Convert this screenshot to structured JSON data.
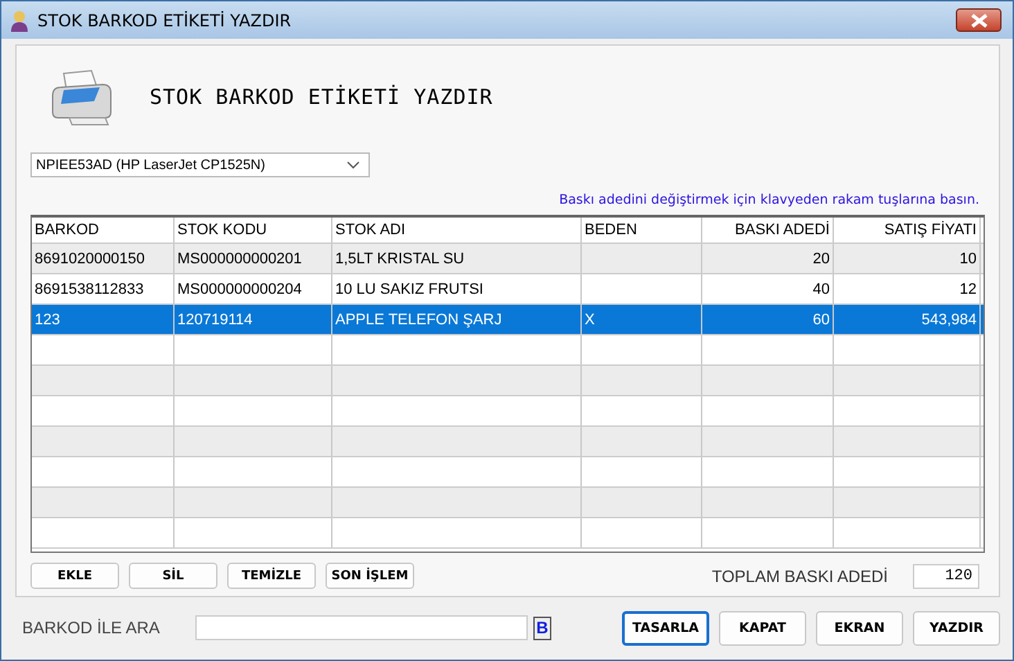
{
  "window": {
    "title": "STOK BARKOD ETİKETİ YAZDIR"
  },
  "header": {
    "title": "STOK BARKOD ETİKETİ YAZDIR"
  },
  "printer": {
    "value": "NPIEE53AD (HP LaserJet CP1525N)"
  },
  "hint": "Baskı adedini değiştirmek için klavyeden rakam tuşlarına basın.",
  "table": {
    "columns": [
      "BARKOD",
      "STOK KODU",
      "STOK ADI",
      "BEDEN",
      "BASKI ADEDİ",
      "SATIŞ FİYATI"
    ],
    "rows": [
      {
        "cells": [
          "8691020000150",
          "MS000000000201",
          "1,5LT KRISTAL SU",
          "",
          "20",
          "10"
        ],
        "selected": false
      },
      {
        "cells": [
          "8691538112833",
          "MS000000000204",
          "10 LU SAKIZ FRUTSI",
          "",
          "40",
          "12"
        ],
        "selected": false
      },
      {
        "cells": [
          "123",
          "120719114",
          "APPLE TELEFON ŞARJ",
          "X",
          "60",
          "543,984"
        ],
        "selected": true
      }
    ]
  },
  "grid_buttons": [
    "EKLE",
    "SİL",
    "TEMİZLE",
    "SON İŞLEM"
  ],
  "total": {
    "label": "TOPLAM BASKI ADEDİ",
    "value": "120"
  },
  "search": {
    "label": "BARKOD İLE ARA",
    "button": "B"
  },
  "footer_buttons": [
    {
      "label": "TASARLA",
      "focused": true
    },
    {
      "label": "KAPAT",
      "focused": false
    },
    {
      "label": "EKRAN",
      "focused": false
    },
    {
      "label": "YAZDIR",
      "focused": false
    }
  ]
}
